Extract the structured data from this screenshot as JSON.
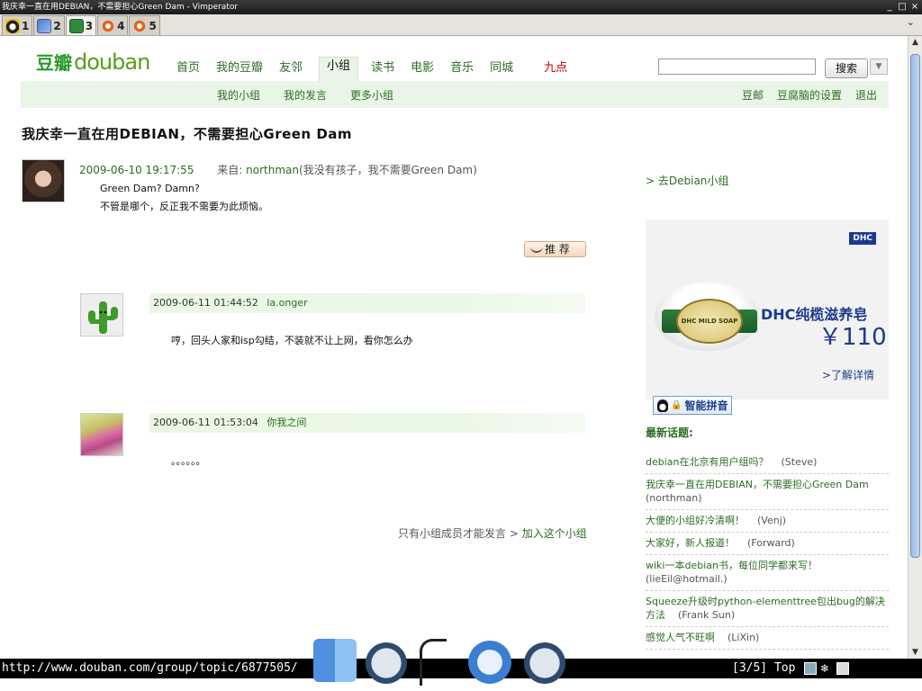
{
  "window": {
    "title": "我庆幸一直在用DEBIAN，不需要担心Green Dam - Vimperator"
  },
  "tabs": [
    {
      "label": "1",
      "icon": "qq-penguin-icon",
      "active": false
    },
    {
      "label": "2",
      "icon": "rss-feed-icon",
      "active": false
    },
    {
      "label": "3",
      "icon": "douban-icon",
      "active": true
    },
    {
      "label": "4",
      "icon": "ubuntu-icon",
      "active": false
    },
    {
      "label": "5",
      "icon": "ubuntu-icon",
      "active": false
    }
  ],
  "site": {
    "logo_cn": "豆瓣",
    "logo_en": "douban",
    "nav": [
      "首页",
      "我的豆瓣",
      "友邻",
      "小组",
      "读书",
      "电影",
      "音乐",
      "同城",
      "九点"
    ],
    "nav_current": "小组",
    "search_button": "搜索",
    "subnav": {
      "my_groups": "我的小组",
      "my_posts": "我的发言",
      "more_groups": "更多小组",
      "mail": "豆邮",
      "settings": "豆腐脑的设置",
      "logout": "退出"
    }
  },
  "topic": {
    "title": "我庆幸一直在用DEBIAN，不需要担心Green Dam",
    "date": "2009-06-10 19:17:55",
    "from_label": "来自:",
    "author": "northman",
    "signature": "(我没有孩子，我不需要Green Dam)",
    "body_line1": "Green Dam? Damn?",
    "body_line2": "不管是哪个，反正我不需要为此烦恼。",
    "recommend": "推 荐"
  },
  "comments": [
    {
      "date": "2009-06-11 01:44:52",
      "user": "la.onger",
      "text": "哼，回头人家和isp勾结，不装就不让上网，看你怎么办"
    },
    {
      "date": "2009-06-11 01:53:04",
      "user": "你我之间",
      "text": "。。。。。。"
    }
  ],
  "join": {
    "notice": "只有小组成员才能发言",
    "link": "加入这个小组"
  },
  "sidebar": {
    "goto_group": "去Debian小组",
    "ad": {
      "brand": "DHC",
      "title": "DHC纯榄滋养皂",
      "price": "￥110",
      "more": ">了解详情",
      "soap_label": "DHC MILD SOAP"
    },
    "ime": "智能拼音",
    "latest_title": "最新话题:",
    "latest": [
      {
        "title": "debian在北京有用户组吗？",
        "author": "(Steve)",
        "br": false
      },
      {
        "title": "我庆幸一直在用DEBIAN，不需要担心Green Dam",
        "author": "(northman)",
        "br": true
      },
      {
        "title": "大便的小组好冷清啊！",
        "author": "(Venj)",
        "br": false
      },
      {
        "title": "大家好，新人报道！",
        "author": "(Forward)",
        "br": false
      },
      {
        "title": "wiki一本debian书，每位同学都来写！",
        "author": "(lieEil@hotmail.)",
        "br": true
      },
      {
        "title": "Squeeze升级时python-elementtree包出bug的解决方法",
        "author": "(Frank Sun)",
        "br": false
      },
      {
        "title": "感觉人气不旺啊",
        "author": "(LiXin)",
        "br": false
      }
    ]
  },
  "status": {
    "url": "http://www.douban.com/group/topic/6877505/",
    "position": "[3/5] Top"
  },
  "colors": {
    "douban_green": "#2b6d22",
    "nav_bg": "#e9f5e6",
    "hot_red": "#cc0000",
    "ad_blue": "#1d3a8c"
  }
}
